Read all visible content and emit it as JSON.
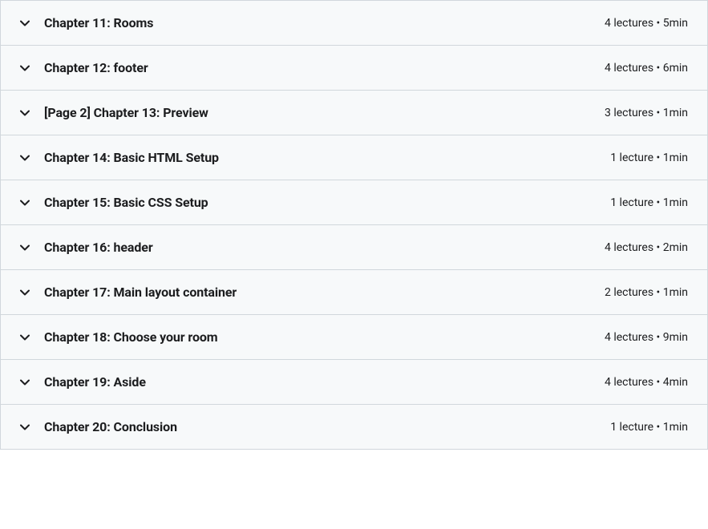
{
  "chapters": [
    {
      "title": "Chapter 11: Rooms",
      "lectures": "4 lectures",
      "duration": "5min"
    },
    {
      "title": "Chapter 12: footer",
      "lectures": "4 lectures",
      "duration": "6min"
    },
    {
      "title": "[Page 2] Chapter 13: Preview",
      "lectures": "3 lectures",
      "duration": "1min"
    },
    {
      "title": "Chapter 14: Basic HTML Setup",
      "lectures": "1 lecture",
      "duration": "1min"
    },
    {
      "title": "Chapter 15: Basic CSS Setup",
      "lectures": "1 lecture",
      "duration": "1min"
    },
    {
      "title": "Chapter 16: header",
      "lectures": "4 lectures",
      "duration": "2min"
    },
    {
      "title": "Chapter 17: Main layout container",
      "lectures": "2 lectures",
      "duration": "1min"
    },
    {
      "title": "Chapter 18: Choose your room",
      "lectures": "4 lectures",
      "duration": "9min"
    },
    {
      "title": "Chapter 19: Aside",
      "lectures": "4 lectures",
      "duration": "4min"
    },
    {
      "title": "Chapter 20: Conclusion",
      "lectures": "1 lecture",
      "duration": "1min"
    }
  ],
  "separator": " • "
}
